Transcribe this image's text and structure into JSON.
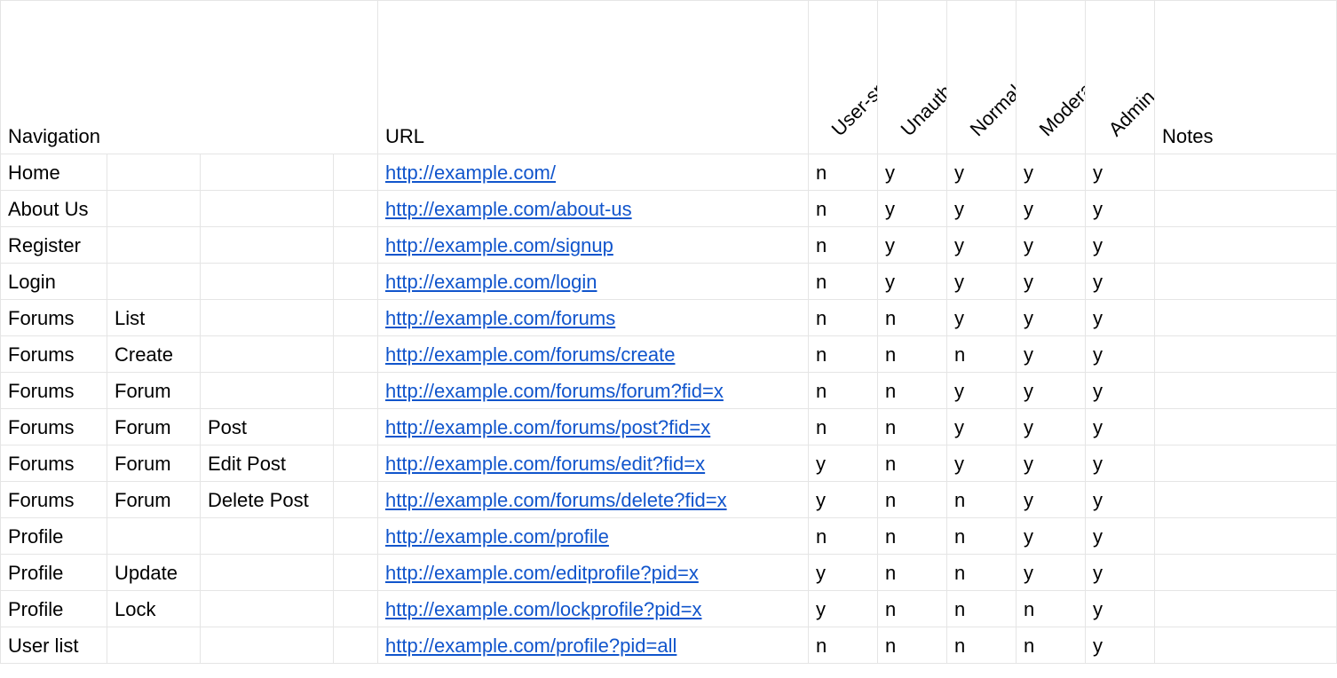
{
  "headers": {
    "navigation": "Navigation",
    "url": "URL",
    "flags": [
      "User-specific?",
      "Unauthenticated",
      "Normal user",
      "Moderator",
      "Admin"
    ],
    "notes": "Notes"
  },
  "rows": [
    {
      "nav": [
        "Home",
        "",
        "",
        ""
      ],
      "url": "http://example.com/",
      "flags": [
        "n",
        "y",
        "y",
        "y",
        "y"
      ],
      "notes": ""
    },
    {
      "nav": [
        "About Us",
        "",
        "",
        ""
      ],
      "url": "http://example.com/about-us",
      "flags": [
        "n",
        "y",
        "y",
        "y",
        "y"
      ],
      "notes": ""
    },
    {
      "nav": [
        "Register",
        "",
        "",
        ""
      ],
      "url": "http://example.com/signup",
      "flags": [
        "n",
        "y",
        "y",
        "y",
        "y"
      ],
      "notes": ""
    },
    {
      "nav": [
        "Login",
        "",
        "",
        ""
      ],
      "url": "http://example.com/login",
      "flags": [
        "n",
        "y",
        "y",
        "y",
        "y"
      ],
      "notes": ""
    },
    {
      "nav": [
        "Forums",
        "List",
        "",
        ""
      ],
      "url": "http://example.com/forums",
      "flags": [
        "n",
        "n",
        "y",
        "y",
        "y"
      ],
      "notes": ""
    },
    {
      "nav": [
        "Forums",
        "Create",
        "",
        ""
      ],
      "url": "http://example.com/forums/create",
      "flags": [
        "n",
        "n",
        "n",
        "y",
        "y"
      ],
      "notes": ""
    },
    {
      "nav": [
        "Forums",
        "Forum",
        "",
        ""
      ],
      "url": "http://example.com/forums/forum?fid=x",
      "flags": [
        "n",
        "n",
        "y",
        "y",
        "y"
      ],
      "notes": ""
    },
    {
      "nav": [
        "Forums",
        "Forum",
        "Post",
        ""
      ],
      "url": "http://example.com/forums/post?fid=x",
      "flags": [
        "n",
        "n",
        "y",
        "y",
        "y"
      ],
      "notes": ""
    },
    {
      "nav": [
        "Forums",
        "Forum",
        "Edit Post",
        ""
      ],
      "url": "http://example.com/forums/edit?fid=x",
      "flags": [
        "y",
        "n",
        "y",
        "y",
        "y"
      ],
      "notes": ""
    },
    {
      "nav": [
        "Forums",
        "Forum",
        "Delete Post",
        ""
      ],
      "url": "http://example.com/forums/delete?fid=x",
      "flags": [
        "y",
        "n",
        "n",
        "y",
        "y"
      ],
      "notes": ""
    },
    {
      "nav": [
        "Profile",
        "",
        "",
        ""
      ],
      "url": "http://example.com/profile",
      "flags": [
        "n",
        "n",
        "n",
        "y",
        "y"
      ],
      "notes": ""
    },
    {
      "nav": [
        "Profile",
        "Update",
        "",
        ""
      ],
      "url": "http://example.com/editprofile?pid=x",
      "flags": [
        "y",
        "n",
        "n",
        "y",
        "y"
      ],
      "notes": ""
    },
    {
      "nav": [
        "Profile",
        "Lock",
        "",
        ""
      ],
      "url": "http://example.com/lockprofile?pid=x",
      "flags": [
        "y",
        "n",
        "n",
        "n",
        "y"
      ],
      "notes": ""
    },
    {
      "nav": [
        "User list",
        "",
        "",
        ""
      ],
      "url": "http://example.com/profile?pid=all",
      "flags": [
        "n",
        "n",
        "n",
        "n",
        "y"
      ],
      "notes": ""
    }
  ]
}
